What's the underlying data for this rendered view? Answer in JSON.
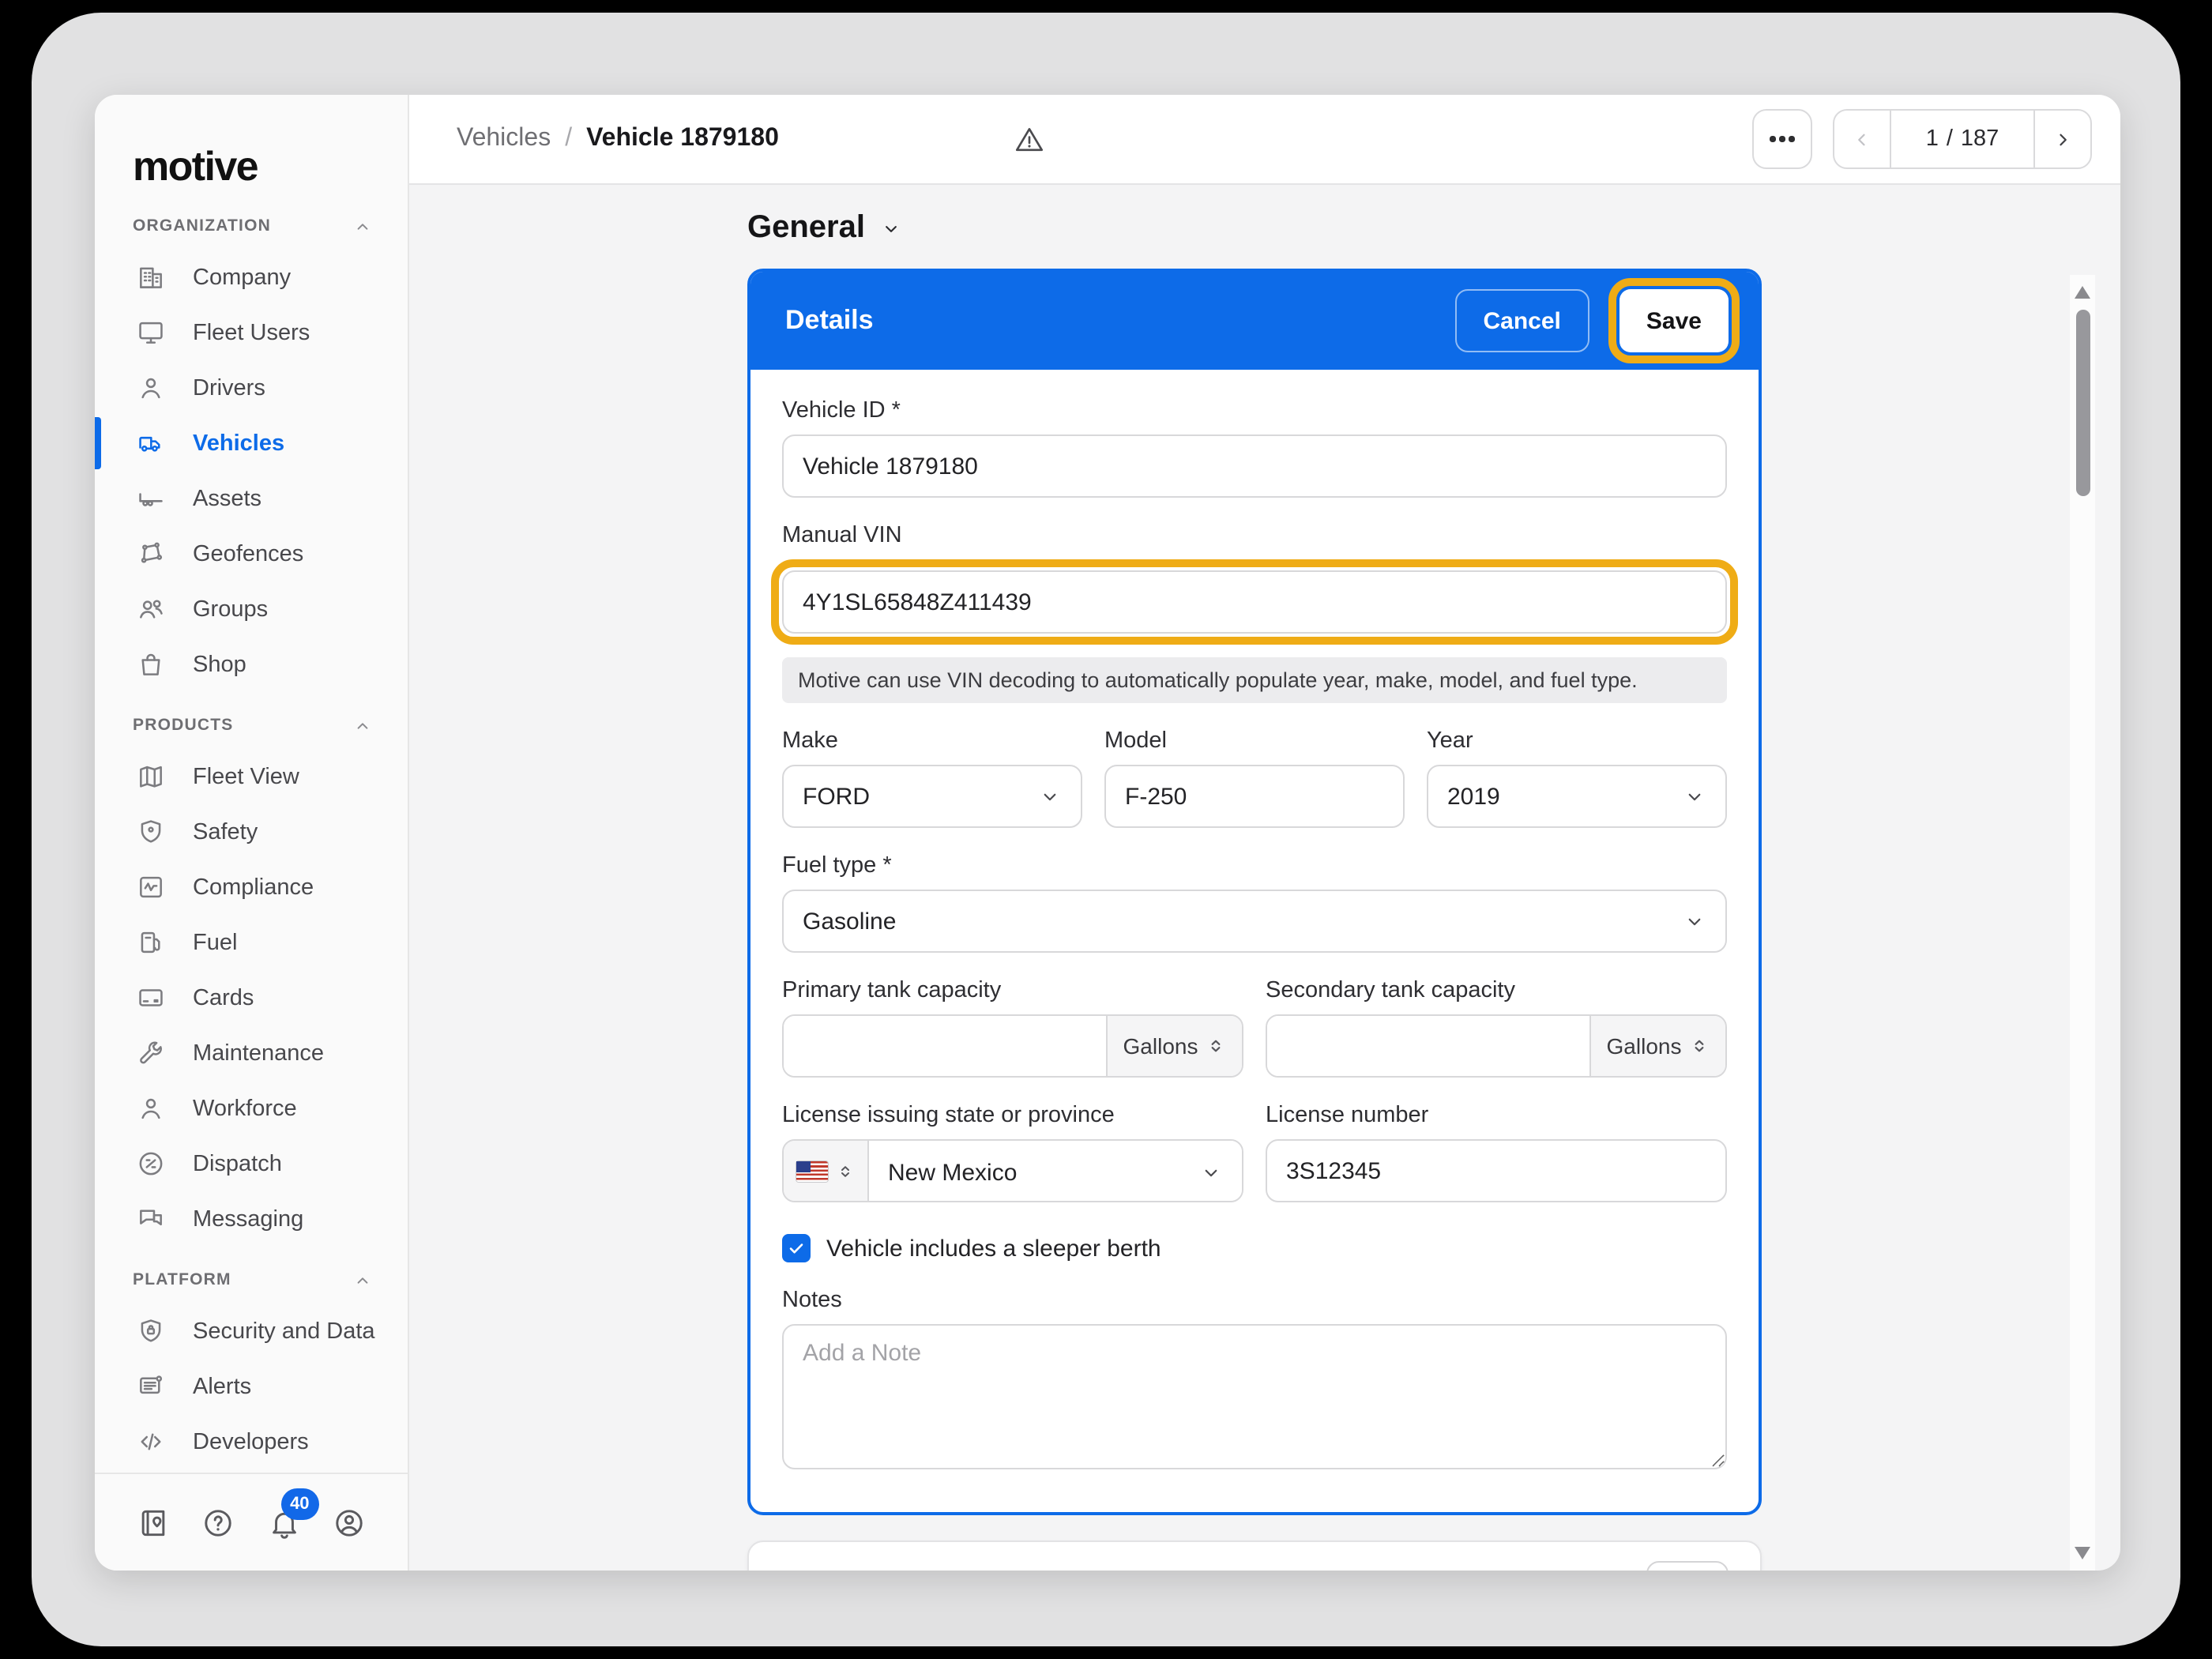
{
  "colors": {
    "accent_blue": "#0D6BE8",
    "active_blue": "#1268E8",
    "annotation_orange": "#EFAC16",
    "badge_blue": "#1268E8"
  },
  "sidebar": {
    "logo_text": "motive",
    "sections": [
      {
        "label": "ORGANIZATION",
        "collapse_icon": "chevron-up-icon",
        "items": [
          {
            "label": "Company",
            "icon": "company-icon"
          },
          {
            "label": "Fleet Users",
            "icon": "monitor-icon"
          },
          {
            "label": "Drivers",
            "icon": "person-icon"
          },
          {
            "label": "Vehicles",
            "icon": "truck-icon",
            "active": true
          },
          {
            "label": "Assets",
            "icon": "trailer-icon"
          },
          {
            "label": "Geofences",
            "icon": "geofence-icon"
          },
          {
            "label": "Groups",
            "icon": "groups-icon"
          },
          {
            "label": "Shop",
            "icon": "shopping-bag-icon"
          }
        ]
      },
      {
        "label": "PRODUCTS",
        "collapse_icon": "chevron-up-icon",
        "items": [
          {
            "label": "Fleet View",
            "icon": "map-icon"
          },
          {
            "label": "Safety",
            "icon": "shield-icon"
          },
          {
            "label": "Compliance",
            "icon": "chart-icon"
          },
          {
            "label": "Fuel",
            "icon": "fuel-pump-icon"
          },
          {
            "label": "Cards",
            "icon": "credit-card-icon"
          },
          {
            "label": "Maintenance",
            "icon": "wrench-icon"
          },
          {
            "label": "Workforce",
            "icon": "person-icon"
          },
          {
            "label": "Dispatch",
            "icon": "dispatch-icon"
          },
          {
            "label": "Messaging",
            "icon": "messaging-icon"
          }
        ]
      },
      {
        "label": "PLATFORM",
        "collapse_icon": "chevron-up-icon",
        "items": [
          {
            "label": "Security and Data",
            "icon": "shield-lock-icon"
          },
          {
            "label": "Alerts",
            "icon": "alerts-icon"
          },
          {
            "label": "Developers",
            "icon": "code-icon"
          }
        ]
      }
    ],
    "footer": {
      "icons": [
        {
          "name": "logbook-icon"
        },
        {
          "name": "help-icon"
        },
        {
          "name": "notifications-bell-icon",
          "badge": "40"
        },
        {
          "name": "account-icon"
        }
      ]
    }
  },
  "header": {
    "breadcrumb": {
      "parent": "Vehicles",
      "separator": "/",
      "current": "Vehicle 1879180"
    },
    "warning_icon": "warning-triangle-icon",
    "more_icon": "ellipsis-icon",
    "pagination": {
      "current": "1",
      "separator": "/",
      "total": "187",
      "prev_icon": "chevron-left-icon",
      "next_icon": "chevron-right-icon"
    }
  },
  "page": {
    "section_title": "General",
    "section_chevron_icon": "chevron-down-icon"
  },
  "details_card": {
    "title": "Details",
    "cancel_label": "Cancel",
    "save_label": "Save",
    "fields": {
      "vehicle_id": {
        "label": "Vehicle ID *",
        "value": "Vehicle 1879180"
      },
      "manual_vin": {
        "label": "Manual VIN",
        "value": "4Y1SL65848Z411439",
        "helper": "Motive can use VIN decoding to automatically populate year, make, model, and fuel type."
      },
      "make": {
        "label": "Make",
        "value": "FORD"
      },
      "model": {
        "label": "Model",
        "value": "F-250"
      },
      "year": {
        "label": "Year",
        "value": "2019"
      },
      "fuel_type": {
        "label": "Fuel type *",
        "value": "Gasoline"
      },
      "primary_tank": {
        "label": "Primary tank capacity",
        "value": "",
        "unit": "Gallons"
      },
      "secondary_tank": {
        "label": "Secondary tank capacity",
        "value": "",
        "unit": "Gallons"
      },
      "license_state": {
        "label": "License issuing state or province",
        "value": "New Mexico",
        "flag": "us-flag-icon"
      },
      "license_number": {
        "label": "License number",
        "value": "3S12345"
      },
      "sleeper_berth": {
        "label": "Vehicle includes a sleeper berth",
        "checked": true
      },
      "notes": {
        "label": "Notes",
        "placeholder": "Add a Note"
      }
    }
  }
}
